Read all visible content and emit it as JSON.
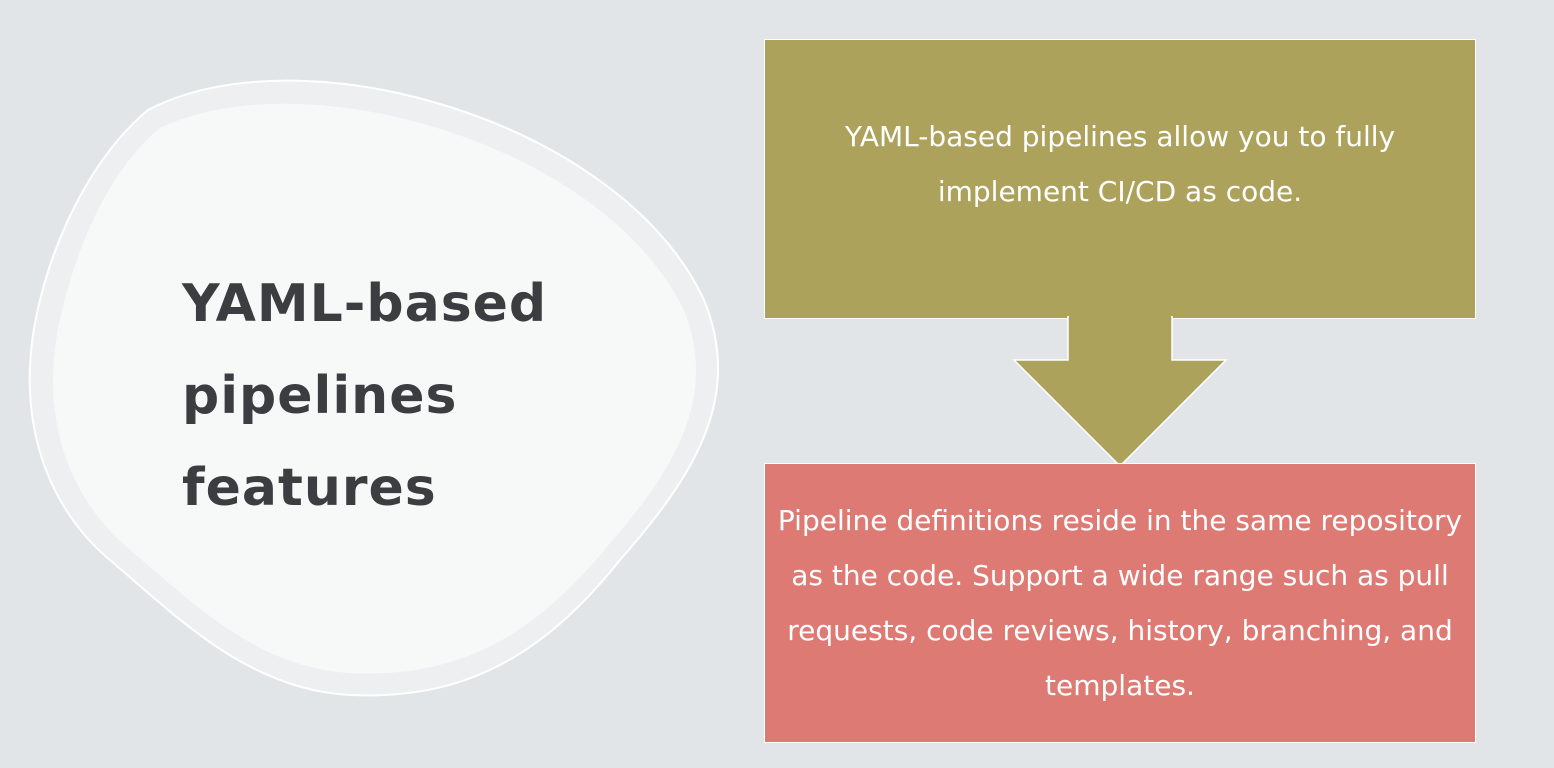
{
  "title": {
    "line1": "YAML-based",
    "line2": "pipelines",
    "line3": "features"
  },
  "steps": [
    {
      "text": "YAML-based pipelines allow you to fully implement CI/CD as code.",
      "color": "#ada25c"
    },
    {
      "text": "Pipeline definitions reside in the same repository as the code. Support a wide range such as pull requests, code reviews, history, branching, and templates.",
      "color": "#de7a74"
    }
  ],
  "colors": {
    "background": "#e2e5e8",
    "blob_fill": "#f7f8f8",
    "blob_ring": "#eeeff1",
    "title_text": "#3c3d40"
  }
}
